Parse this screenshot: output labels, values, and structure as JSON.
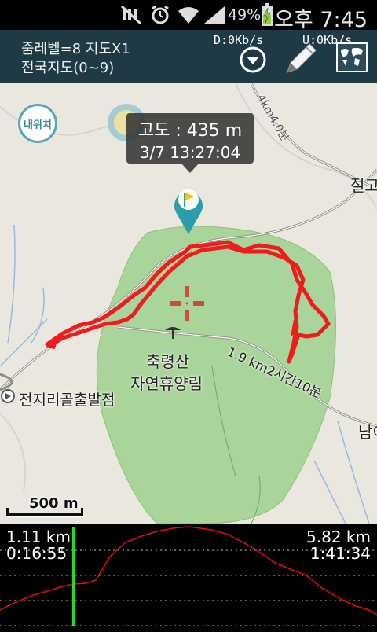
{
  "status_bar": {
    "battery_percent": "49%",
    "clock": "오후 7:45",
    "icons": [
      "no-signal-icon",
      "alarm-icon",
      "wifi-icon",
      "signal-bars-icon",
      "battery-charging-icon"
    ]
  },
  "header": {
    "zoom_line": "줌레벨=8 지도X1",
    "map_line": "전국지도(0~9)",
    "download_speed": "D:0Kb/s",
    "upload_speed": "U:0Kb/s",
    "icons": [
      "dropdown-icon",
      "pencil-icon",
      "world-map-icon"
    ]
  },
  "map": {
    "my_location_label": "내위치",
    "tooltip": {
      "altitude": "고도 : 435 m",
      "datetime": "3/7 13:27:04"
    },
    "labels": {
      "park_name_1": "축령산",
      "park_name_2": "자연휴양림",
      "start_point": "전지리골출발점",
      "trail_info": "1.9 km2시간10분",
      "trail_info_top": "4km4.0분",
      "edge_label_right": "절고",
      "edge_label_bottom": "남이"
    },
    "scale": "500 m",
    "colors": {
      "park_green": "#a9d49a",
      "track_red": "#ee1c1c",
      "marker_teal": "#2a9eaa"
    }
  },
  "elevation_panel": {
    "cursor_distance": "1.11 km",
    "cursor_time": "0:16:55",
    "total_distance": "5.82 km",
    "total_time": "1:41:34",
    "colors": {
      "profile": "#e01010",
      "cursor": "#22dd22"
    }
  }
}
